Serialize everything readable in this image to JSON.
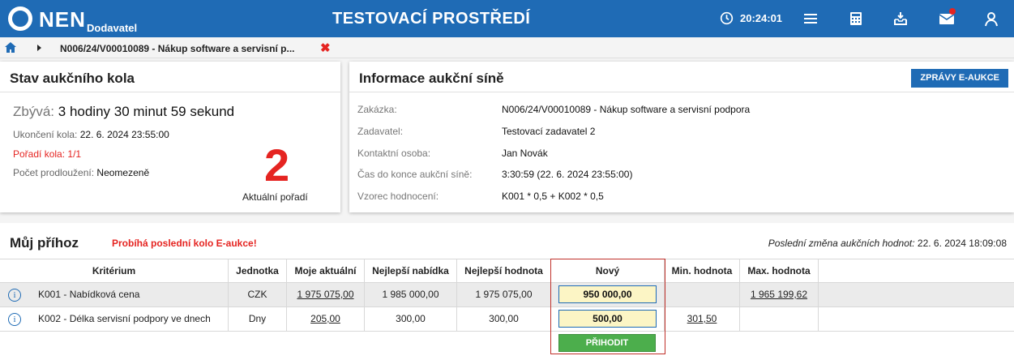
{
  "header": {
    "logo_text": "NEN",
    "logo_sub": "Dodavatel",
    "environment_title": "TESTOVACÍ PROSTŘEDÍ",
    "clock": "20:24:01"
  },
  "breadcrumb": {
    "current": "N006/24/V00010089 - Nákup software a servisní p...",
    "close_glyph": "✖"
  },
  "round_status": {
    "title": "Stav aukčního kola",
    "remaining_label": "Zbývá:",
    "remaining_value": "3 hodiny 30 minut 59 sekund",
    "end_label": "Ukončení kola:",
    "end_value": "22. 6. 2024 23:55:00",
    "order_label": "Pořadí kola:",
    "order_value": "1/1",
    "extensions_label": "Počet prodloužení:",
    "extensions_value": "Neomezeně",
    "current_rank": "2",
    "current_rank_label": "Aktuální pořadí"
  },
  "auction_info": {
    "title": "Informace aukční síně",
    "messages_button": "ZPRÁVY E-AUKCE",
    "rows": [
      {
        "label": "Zakázka:",
        "value": "N006/24/V00010089 - Nákup software a servisní podpora"
      },
      {
        "label": "Zadavatel:",
        "value": "Testovací zadavatel 2"
      },
      {
        "label": "Kontaktní osoba:",
        "value": "Jan Novák"
      },
      {
        "label": "Čas do konce aukční síně:",
        "value": "3:30:59 (22. 6. 2024 23:55:00)"
      },
      {
        "label": "Vzorec hodnocení:",
        "value": "K001 * 0,5 + K002 * 0,5"
      }
    ]
  },
  "my_bid": {
    "title": "Můj příhoz",
    "alert": "Probíhá poslední kolo E-aukce!",
    "last_change_label": "Poslední změna aukčních hodnot:",
    "last_change_value": "22. 6. 2024 18:09:08",
    "columns": [
      "Kritérium",
      "Jednotka",
      "Moje aktuální",
      "Nejlepší nabídka",
      "Nejlepší hodnota",
      "Nový",
      "Min. hodnota",
      "Max. hodnota"
    ],
    "rows": [
      {
        "criterion": "K001 - Nabídková cena",
        "unit": "CZK",
        "my_current": "1 975 075,00",
        "best_offer": "1 985 000,00",
        "best_value": "1 975 075,00",
        "new": "950 000,00",
        "min": "",
        "max": "1 965 199,62"
      },
      {
        "criterion": "K002 - Délka servisní podpory ve dnech",
        "unit": "Dny",
        "my_current": "205,00",
        "best_offer": "300,00",
        "best_value": "300,00",
        "new": "500,00",
        "min": "301,50",
        "max": ""
      }
    ],
    "bid_button": "PŘIHODIT",
    "info_glyph": "i"
  },
  "colors": {
    "brand_blue": "#1f6bb5",
    "alert_red": "#e52421",
    "bid_green": "#4cae4c",
    "input_yellow": "#fcf5c5"
  }
}
